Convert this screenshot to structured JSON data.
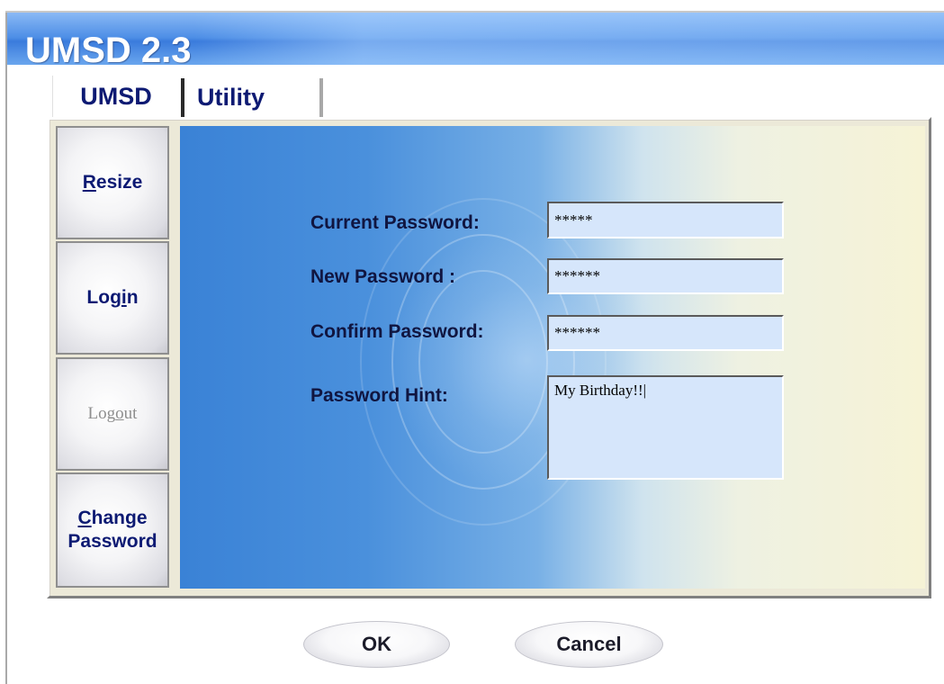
{
  "window": {
    "title": "UMSD 2.3"
  },
  "tabs": [
    {
      "label": "UMSD",
      "selected": true
    },
    {
      "label": "Utility",
      "selected": false
    }
  ],
  "sidebar": {
    "items": [
      {
        "pre": "",
        "ul": "R",
        "post": "esize",
        "enabled": true
      },
      {
        "pre": "Log",
        "ul": "i",
        "post": "n",
        "enabled": true
      },
      {
        "pre": "Log",
        "ul": "o",
        "post": "ut",
        "enabled": false
      },
      {
        "line1_pre": "",
        "line1_ul": "C",
        "line1_post": "hange",
        "line2": "Password",
        "enabled": true
      }
    ]
  },
  "form": {
    "current_password_label": "Current Password:",
    "current_password_value": "*****",
    "new_password_label": "New Password :",
    "new_password_value": "******",
    "confirm_password_label": "Confirm Password:",
    "confirm_password_value": "******",
    "password_hint_label": "Password Hint:",
    "password_hint_value": "My Birthday!!|"
  },
  "footer": {
    "ok_label": "OK",
    "cancel_label": "Cancel"
  },
  "colors": {
    "title_bar": "#4d8ee6",
    "label_text": "#0d1a73",
    "input_bg": "#d6e6fb"
  }
}
